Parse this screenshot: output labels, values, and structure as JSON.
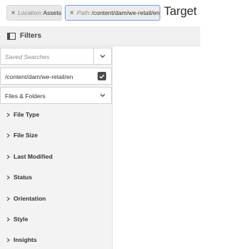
{
  "omnisearch": {
    "tags": [
      {
        "key": "Location:",
        "value": "Assets"
      },
      {
        "key": "Path:",
        "value": "/content/dam/we-retail/en"
      }
    ],
    "query_text": "Target"
  },
  "rail": {
    "title": "Filters",
    "saved_searches_placeholder": "Saved Searches",
    "path_value": "/content/dam/we-retail/en",
    "path_checked": true,
    "scope_dropdown": "Files & Folders",
    "facets": [
      "File Type",
      "File Size",
      "Last Modified",
      "Status",
      "Orientation",
      "Style",
      "Insights"
    ]
  },
  "colors": {
    "focus_border": "#6e9fe8",
    "rail_background": "#f3f3f3"
  },
  "icons": [
    "close-icon",
    "filter-panel-icon",
    "chevron-down-icon",
    "checkmark-icon",
    "chevron-right-icon"
  ]
}
